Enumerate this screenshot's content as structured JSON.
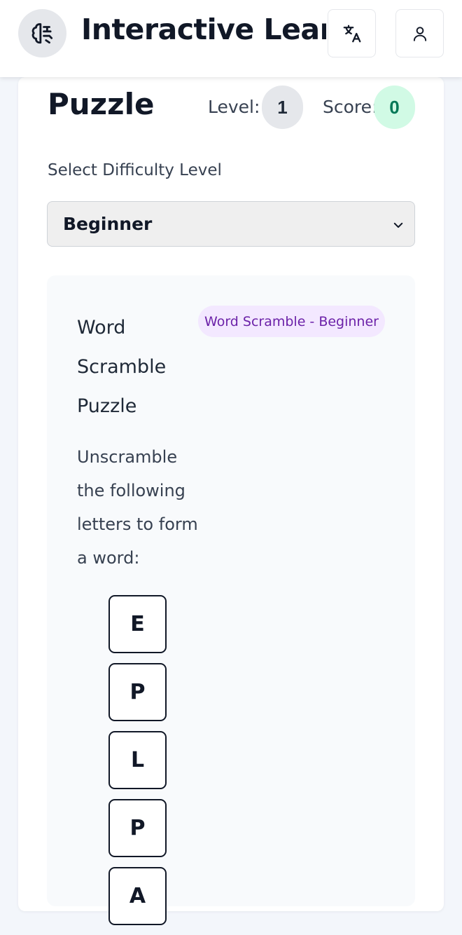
{
  "header": {
    "app_title": "Interactive Learning",
    "logo_icon": "brain-icon",
    "translate_icon": "translate-icon",
    "profile_icon": "user-icon"
  },
  "game": {
    "title": "Puzzle",
    "level_label": "Level:",
    "level_value": "1",
    "score_label": "Score:",
    "score_value": "0"
  },
  "difficulty": {
    "label": "Select Difficulty Level",
    "selected": "Beginner"
  },
  "puzzle": {
    "title": "Word Scramble Puzzle",
    "badge": "Word Scramble - Beginner",
    "instructions": "Unscramble the following letters to form a word:",
    "letters": [
      "E",
      "P",
      "L",
      "P",
      "A"
    ]
  },
  "colors": {
    "level_pill": "#e5e7eb",
    "score_pill": "#d1fae5",
    "score_text": "#047857",
    "badge_bg": "#f3e8ff",
    "badge_text": "#6b21a8"
  }
}
